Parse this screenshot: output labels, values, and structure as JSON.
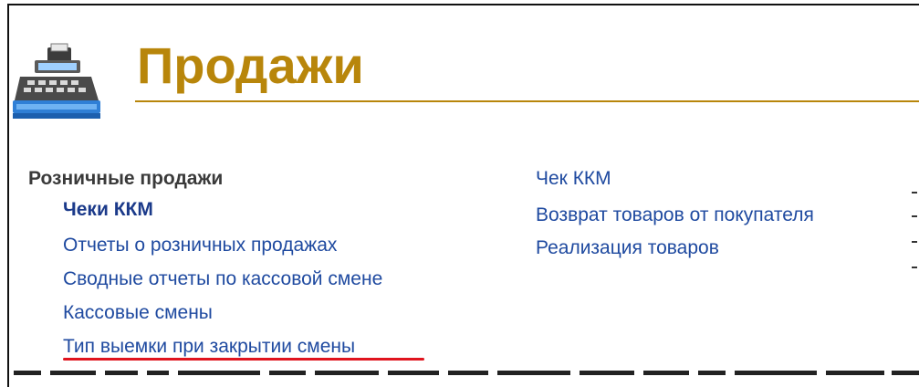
{
  "header": {
    "icon": "cash-register-icon",
    "title": "Продажи",
    "accent_color": "#b8860b"
  },
  "retail": {
    "group_title": "Розничные продажи",
    "links": [
      "Чеки ККМ",
      "Отчеты о розничных продажах",
      "Сводные отчеты по кассовой смене",
      "Кассовые смены",
      "Тип выемки при закрытии смены"
    ]
  },
  "create_links": [
    "Чек ККМ",
    "Возврат товаров от покупателя",
    "Реализация товаров"
  ],
  "highlight_color": "#e0141e"
}
